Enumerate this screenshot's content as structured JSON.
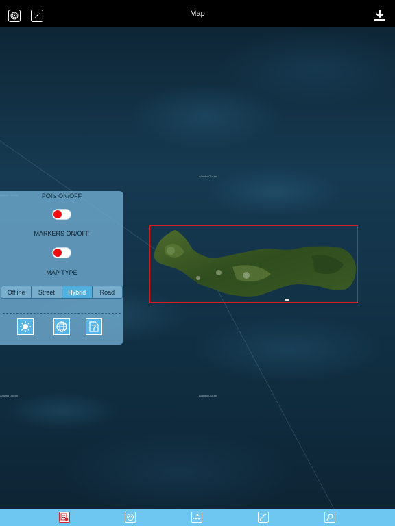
{
  "header": {
    "title": "Map",
    "left_icons": [
      "target-icon",
      "compass-icon"
    ],
    "right_icon": "download-icon"
  },
  "map": {
    "ocean_labels": [
      "Atlantic Ocean",
      "Atlantic Ocean",
      "Atlantic Ocean",
      "Atlantic Ocean"
    ],
    "highlight_color": "#e01c1c"
  },
  "panel": {
    "poi_label": "POI's ON/OFF",
    "poi_on": false,
    "markers_label": "MARKERS ON/OFF",
    "markers_on": false,
    "map_type_label": "MAP TYPE",
    "map_types": [
      "Offline",
      "Street",
      "Hybrid",
      "Road"
    ],
    "selected_map_type": "Hybrid",
    "buttons": [
      "brightness-icon",
      "globe-icon",
      "help-icon"
    ]
  },
  "bottom_nav": {
    "items": [
      "settings-list-icon",
      "layers-icon",
      "weather-icon",
      "route-icon",
      "search-icon"
    ],
    "selected": "settings-list-icon"
  },
  "colors": {
    "top_bar": "#000000",
    "bottom_bar": "#6ec7f1",
    "panel": "#6eaacd",
    "toggle_knob": "#f00d0d",
    "segment_active": "#4fb0e0"
  }
}
